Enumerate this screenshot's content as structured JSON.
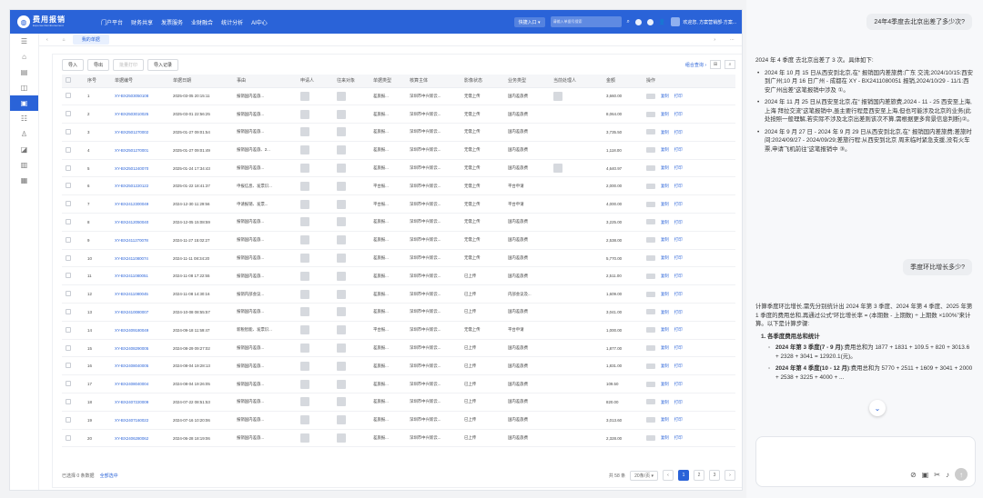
{
  "app": {
    "logo_title": "费用报销",
    "logo_subtitle": "Expense Reimbursement",
    "nav": [
      "门户平台",
      "财务共享",
      "发票服务",
      "业财融合",
      "统计分析",
      "AI中心"
    ],
    "quick_entry": "快捷入口",
    "search_placeholder": "请输入单据号搜索",
    "user_label": "欢迎您,  方案营销部-方案..."
  },
  "tabs": {
    "home": "⌂",
    "active": "我的单据"
  },
  "toolbar": {
    "buttons": [
      "导入",
      "导出",
      "批量打印",
      "导入记录"
    ],
    "advanced_search": "组合查询"
  },
  "table": {
    "headers": [
      "序号",
      "单据编号",
      "单据日期",
      "事由",
      "申请人",
      "往来对象",
      "单据类型",
      "核算主体",
      "影像状态",
      "业务类型",
      "当前处理人",
      "金额",
      "操作"
    ],
    "rows": [
      {
        "no": "1",
        "id": "XY-BX2503050108",
        "date": "2025-03-05 20:15:11",
        "reason": "报销国内差旅...",
        "type": "差旅报...",
        "entity": "深圳市中兴新云...",
        "image": "无需上传",
        "biz": "国内差旅费",
        "amount": "3,660.00"
      },
      {
        "no": "2",
        "id": "XY-BX2503010025",
        "date": "2025-03-01 22:56:25",
        "reason": "报销国内差旅...",
        "type": "差旅报...",
        "entity": "深圳市中兴新云...",
        "image": "无需上传",
        "biz": "国内差旅费",
        "amount": "8,064.00"
      },
      {
        "no": "3",
        "id": "XY-BX2501270002",
        "date": "2025-01-27 09:01:54",
        "reason": "报销国内差旅...",
        "type": "差旅报...",
        "entity": "深圳市中兴新云...",
        "image": "无需上传",
        "biz": "国内差旅费",
        "amount": "3,735.50"
      },
      {
        "no": "4",
        "id": "XY-BX2501270001",
        "date": "2025-01-27 09:01:49",
        "reason": "报销国内差旅、2...",
        "type": "差旅报...",
        "entity": "深圳市中兴新云...",
        "image": "无需上传",
        "biz": "国内差旅费",
        "amount": "1,118.00"
      },
      {
        "no": "5",
        "id": "XY-BX2501240070",
        "date": "2025-01-24 17:34:43",
        "reason": "报销国内差旅...",
        "type": "差旅报...",
        "entity": "深圳市中兴新云...",
        "image": "无需上传",
        "biz": "国内差旅费",
        "amount": "4,640.97"
      },
      {
        "no": "6",
        "id": "XY-BX2501220122",
        "date": "2025-01-22 18:41:37",
        "reason": "申报信息、发票识...",
        "type": "平台报...",
        "entity": "深圳市中兴新云...",
        "image": "无需上传",
        "biz": "平台申请",
        "amount": "2,000.00"
      },
      {
        "no": "7",
        "id": "XY-BX2412300049",
        "date": "2024-12-30 11:29:56",
        "reason": "申请报销、发票...",
        "type": "平台报...",
        "entity": "深圳市中兴新云...",
        "image": "无需上传",
        "biz": "平台申请",
        "amount": "4,000.00"
      },
      {
        "no": "8",
        "id": "XY-BX2412050040",
        "date": "2024-12-05 15:08:59",
        "reason": "报销国内差旅...",
        "type": "差旅报...",
        "entity": "深圳市中兴新云...",
        "image": "无需上传",
        "biz": "国内差旅费",
        "amount": "3,225.00"
      },
      {
        "no": "9",
        "id": "XY-BX2411270078",
        "date": "2024-11-27 15:02:27",
        "reason": "报销国内差旅...",
        "type": "差旅报...",
        "entity": "深圳市中兴新云...",
        "image": "无需上传",
        "biz": "国内差旅费",
        "amount": "2,538.00"
      },
      {
        "no": "10",
        "id": "XY-BX2411080074",
        "date": "2024-11-11 08:34:20",
        "reason": "报销国内差旅...",
        "type": "差旅报...",
        "entity": "深圳市中兴新云...",
        "image": "无需上传",
        "biz": "国内差旅费",
        "amount": "5,770.00"
      },
      {
        "no": "11",
        "id": "XY-BX2411080051",
        "date": "2024-11-08 17:22:55",
        "reason": "报销国内差旅...",
        "type": "差旅报...",
        "entity": "深圳市中兴新云...",
        "image": "已上传",
        "biz": "国内差旅费",
        "amount": "2,511.00"
      },
      {
        "no": "12",
        "id": "XY-BX2411080045",
        "date": "2024-11-08 14:30:16",
        "reason": "报销内部会议...",
        "type": "差旅报...",
        "entity": "深圳市中兴新云...",
        "image": "已上传",
        "biz": "内部会议及...",
        "amount": "1,609.00"
      },
      {
        "no": "13",
        "id": "XY-BX2410080007",
        "date": "2024-10-08 08:55:57",
        "reason": "报销国内差旅...",
        "type": "差旅报...",
        "entity": "深圳市中兴新云...",
        "image": "已上传",
        "biz": "国内差旅费",
        "amount": "3,041.00"
      },
      {
        "no": "14",
        "id": "XY-BX2409180049",
        "date": "2024-09-18 11:59:47",
        "reason": "新税智能、发票识...",
        "type": "平台报...",
        "entity": "深圳市中兴新云...",
        "image": "无需上传",
        "biz": "平台申请",
        "amount": "1,000.00"
      },
      {
        "no": "15",
        "id": "XY-BX2408290005",
        "date": "2024-08-29 09:27:02",
        "reason": "报销国内差旅...",
        "type": "差旅报...",
        "entity": "深圳市中兴新云...",
        "image": "已上传",
        "biz": "国内差旅费",
        "amount": "1,877.00"
      },
      {
        "no": "16",
        "id": "XY-BX2408040005",
        "date": "2024-08-04 19:28:13",
        "reason": "报销国内差旅...",
        "type": "差旅报...",
        "entity": "深圳市中兴新云...",
        "image": "已上传",
        "biz": "国内差旅费",
        "amount": "1,831.00"
      },
      {
        "no": "17",
        "id": "XY-BX2408040004",
        "date": "2024-08-04 19:26:05",
        "reason": "报销国内差旅...",
        "type": "差旅报...",
        "entity": "深圳市中兴新云...",
        "image": "已上传",
        "biz": "国内差旅费",
        "amount": "109.50"
      },
      {
        "no": "18",
        "id": "XY-BX2407220009",
        "date": "2024-07-22 08:51:53",
        "reason": "报销国内差旅...",
        "type": "差旅报...",
        "entity": "深圳市中兴新云...",
        "image": "已上传",
        "biz": "国内差旅费",
        "amount": "820.00"
      },
      {
        "no": "19",
        "id": "XY-BX2407160022",
        "date": "2024-07-16 10:20:06",
        "reason": "报销国内差旅...",
        "type": "差旅报...",
        "entity": "深圳市中兴新云...",
        "image": "已上传",
        "biz": "国内差旅费",
        "amount": "3,013.60"
      },
      {
        "no": "20",
        "id": "XY-BX2406280062",
        "date": "2024-06-28 18:19:06",
        "reason": "报销国内差旅...",
        "type": "差旅报...",
        "entity": "深圳市中兴新云...",
        "image": "已上传",
        "biz": "国内差旅费",
        "amount": "2,328.00"
      }
    ],
    "op_copy": "复制",
    "op_print": "打印"
  },
  "footer": {
    "selected": "已选择 0 条数据",
    "select_all": "全部选中",
    "total": "共 58 条",
    "page_size": "20条/页",
    "pages": [
      "1",
      "2",
      "3"
    ],
    "current_page": "1"
  },
  "chat": {
    "q1": "24年4季度去北京出差了多少次?",
    "a1_intro": "2024 年 4 季度    去北京出差了 3 次。具体如下:",
    "a1_items": [
      "2024 年 10 月 15 日从西安到北京,在“    报销国内差旅费:广东    交流;2024/10/15:西安到广州;10 月 16 日广州 - 成都在 XY - BX2411080051 报销,2024/10/29 - 11/1:西安广州出差”这笔报销中涉及 ①。",
      "2024 年 11 月 25 日从西安至北京,在“    报销国内差旅费,2024 - 11 - 25 西安至上海,上海    拜拉交流”这笔报销中,虽主要行程是西安至上海,但也可能涉及北京的业务(此处按照一般理解,若实际不涉及北京出差则该次不算,需根据更多背景信息判断)②。",
      "2024 年 9 月 27 日 - 2024 年 9 月 29 日从西安到北京,在“    报销国内差旅费;差旅时间:2024/09/27 - 2024/09/29;差旅行程:从西安到北京 周末临时紧急支援,没有火车票,申请飞机前往”这笔报销中 ③。"
    ],
    "q2": "季度环比增长多少?",
    "a2_intro": "计算季度环比增长,需先分别统计出 2024 年第 3 季度、2024 年第 4 季度、2025 年第 1 季度的费用总和,再通过公式“环比增长率 = (本期数 - 上期数) ÷ 上期数 ×100%”来计算。以下是计算步骤:",
    "a2_step1": "1.  各季度费用总和统计",
    "a2_q3_label": "2024 年第 3 季度(7 - 9 月)",
    "a2_q3_text": ":费用总和为 1877 + 1831 + 109.5 + 820 + 3013.6 + 2328 + 3041 = 12920.1(元)。",
    "a2_q4_label": "2024 年第 4 季度(10 - 12 月)",
    "a2_q4_text": ":费用总和为 5770 + 2511 + 1609 + 3041 + 2000 + 2538 + 3225 + 4000 + ..."
  }
}
